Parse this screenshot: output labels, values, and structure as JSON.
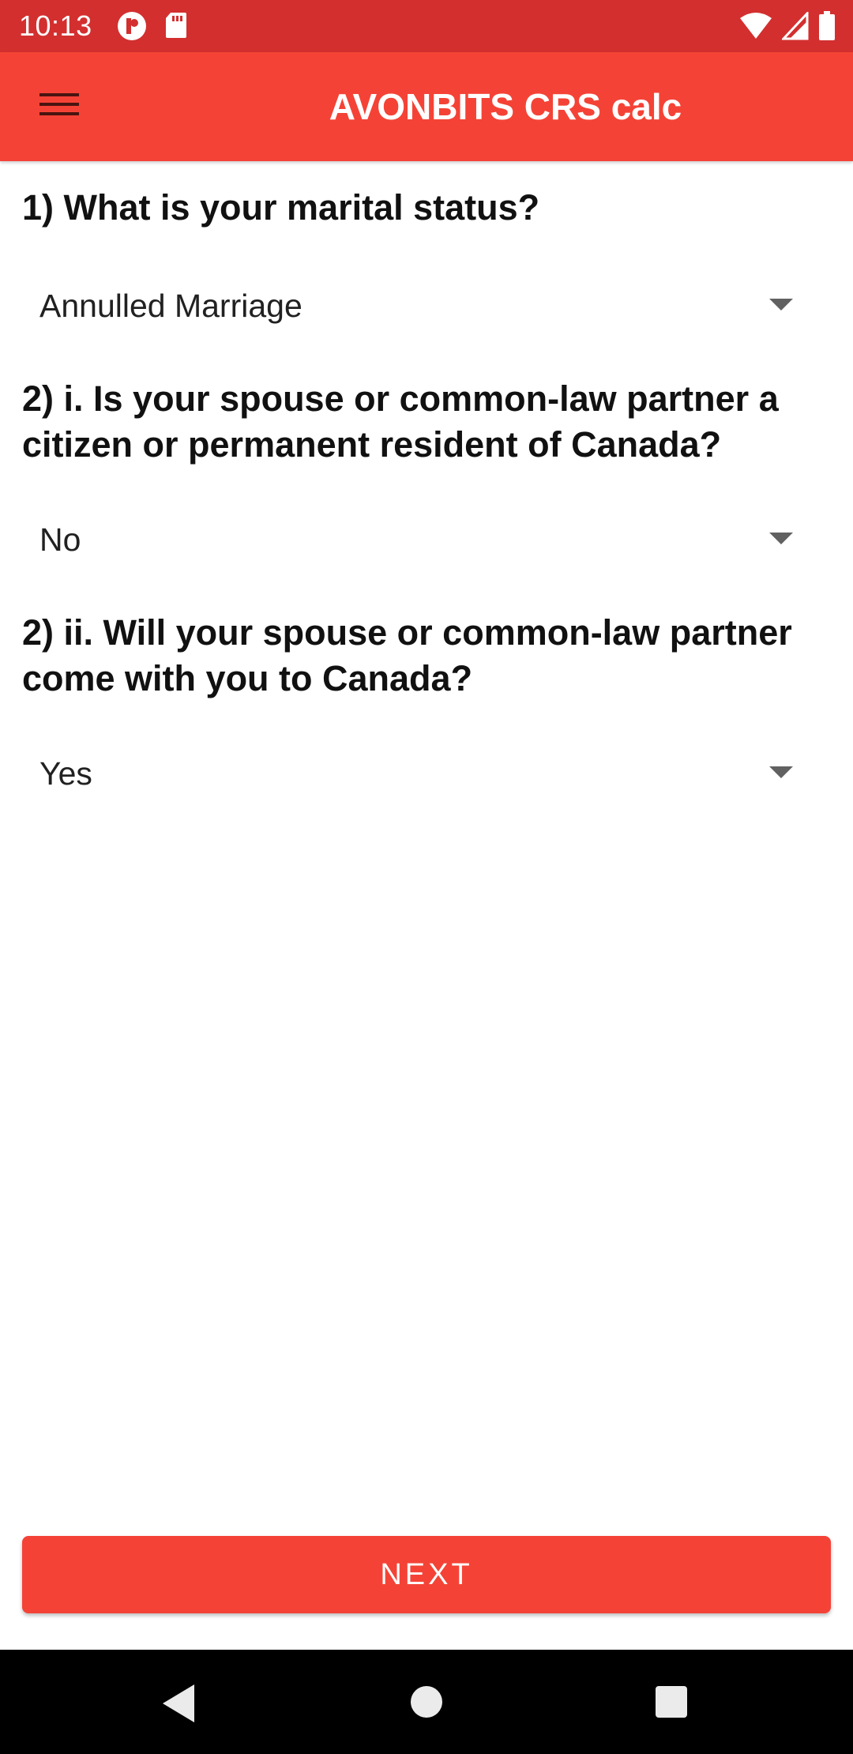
{
  "status_bar": {
    "time": "10:13",
    "left_icons": [
      "notification-p-icon",
      "sd-card-icon"
    ],
    "right_icons": [
      "wifi-icon",
      "cellular-signal-icon",
      "battery-icon"
    ]
  },
  "app_bar": {
    "title": "AVONBITS CRS calc",
    "menu_icon": "hamburger-menu-icon"
  },
  "questions": [
    {
      "label": "1) What is your marital status?",
      "selected": "Annulled Marriage"
    },
    {
      "label": "2) i. Is your spouse or common-law partner a citizen or permanent resident of Canada?",
      "selected": "No"
    },
    {
      "label": "2) ii. Will your spouse or common-law partner come with you to Canada?",
      "selected": "Yes"
    }
  ],
  "next_button": {
    "label": "NEXT"
  },
  "nav_bar": {
    "icons": [
      "back-icon",
      "home-icon",
      "recents-icon"
    ]
  },
  "colors": {
    "status_bar": "#d32f2f",
    "app_bar": "#f44336",
    "button": "#f44336"
  }
}
